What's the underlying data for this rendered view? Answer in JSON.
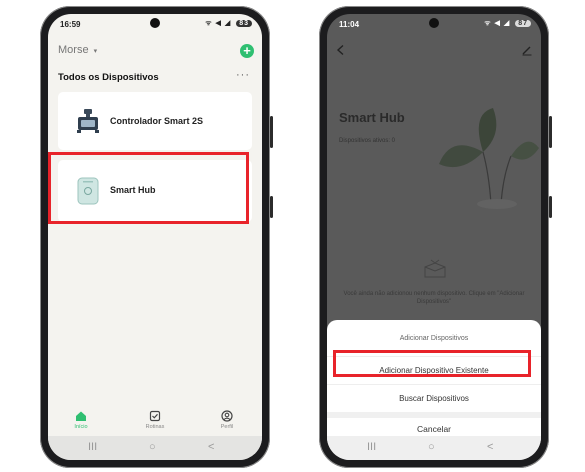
{
  "left_phone": {
    "status": {
      "time": "16:59",
      "icons": "ᯤ ◀ ◢",
      "battery": "83"
    },
    "home": {
      "name": "Morse",
      "caret": "▾",
      "add_symbol": "+"
    },
    "section": {
      "title": "Todos os Dispositivos",
      "more": "···"
    },
    "devices": [
      {
        "name": "Controlador Smart 2S",
        "icon": "smart-controller-icon"
      },
      {
        "name": "Smart Hub",
        "icon": "smart-hub-icon"
      }
    ],
    "tabs": [
      {
        "label": "Início",
        "icon": "home-icon",
        "active": true
      },
      {
        "label": "Rotinas",
        "icon": "routines-icon",
        "active": false
      },
      {
        "label": "Perfil",
        "icon": "profile-icon",
        "active": false
      }
    ],
    "nav": {
      "recent": "III",
      "home": "○",
      "back": "<"
    }
  },
  "right_phone": {
    "status": {
      "time": "11:04",
      "icons": "ᯤ ◀ ◢",
      "battery": "87"
    },
    "hub": {
      "title": "Smart Hub",
      "active_devices": "Dispositivos ativos: 0",
      "empty_message": "Você ainda não adicionou nenhum dispositivo. Clique em \"Adicionar Dispositivos\""
    },
    "sheet": {
      "title": "Adicionar Dispositivos",
      "option_existing": "Adicionar Dispositivo Existente",
      "option_search": "Buscar Dispositivos",
      "cancel": "Cancelar"
    },
    "nav": {
      "recent": "III",
      "home": "○",
      "back": "<"
    }
  },
  "colors": {
    "accent_green": "#2fbf71",
    "highlight_red": "#e8232a"
  }
}
